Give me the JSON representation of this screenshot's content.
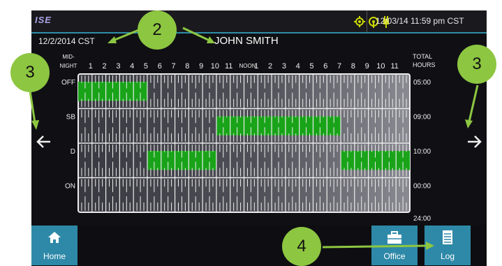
{
  "app": {
    "logo": "ISE",
    "status_icons": [
      "gps-icon",
      "wireless-icon",
      "plug-icon"
    ],
    "datetime": "12/03/14 11:59 pm CST"
  },
  "log_header": {
    "date": "12/2/2014 CST",
    "driver": "JOHN SMITH"
  },
  "nav": {
    "prev_icon": "left-arrow-icon",
    "next_icon": "right-arrow-icon"
  },
  "bottom": {
    "home_label": "Home",
    "office_label": "Office",
    "log_label": "Log"
  },
  "callouts": [
    "2",
    "3",
    "3",
    "4"
  ],
  "colors": {
    "accent": "#2e89a8",
    "duty_bar": "#19a319",
    "callout": "#8dc641"
  },
  "chart_data": {
    "type": "gantt",
    "x_ticks": [
      {
        "top": "MID-",
        "bottom": "NIGHT",
        "value": 0
      },
      {
        "bottom": "1",
        "value": 1
      },
      {
        "bottom": "2",
        "value": 2
      },
      {
        "bottom": "3",
        "value": 3
      },
      {
        "bottom": "4",
        "value": 4
      },
      {
        "bottom": "5",
        "value": 5
      },
      {
        "bottom": "6",
        "value": 6
      },
      {
        "bottom": "7",
        "value": 7
      },
      {
        "bottom": "8",
        "value": 8
      },
      {
        "bottom": "9",
        "value": 9
      },
      {
        "bottom": "10",
        "value": 10
      },
      {
        "bottom": "11",
        "value": 11
      },
      {
        "bottom": "NOON",
        "value": 12
      },
      {
        "bottom": "1",
        "value": 13
      },
      {
        "bottom": "2",
        "value": 14
      },
      {
        "bottom": "3",
        "value": 15
      },
      {
        "bottom": "4",
        "value": 16
      },
      {
        "bottom": "5",
        "value": 17
      },
      {
        "bottom": "6",
        "value": 18
      },
      {
        "bottom": "7",
        "value": 19
      },
      {
        "bottom": "8",
        "value": 20
      },
      {
        "bottom": "9",
        "value": 21
      },
      {
        "bottom": "10",
        "value": 22
      },
      {
        "bottom": "11",
        "value": 23
      }
    ],
    "total_header": [
      "TOTAL",
      "HOURS"
    ],
    "rows": [
      {
        "label": "OFF",
        "total": "05:00",
        "segments": [
          [
            0,
            5
          ]
        ]
      },
      {
        "label": "SB",
        "total": "09:00",
        "segments": [
          [
            10,
            19
          ]
        ]
      },
      {
        "label": "D",
        "total": "10:00",
        "segments": [
          [
            5,
            10
          ],
          [
            19,
            24
          ]
        ]
      },
      {
        "label": "ON",
        "total": "00:00",
        "segments": []
      }
    ],
    "grand_total": "24:00",
    "x_range": [
      0,
      24
    ]
  }
}
